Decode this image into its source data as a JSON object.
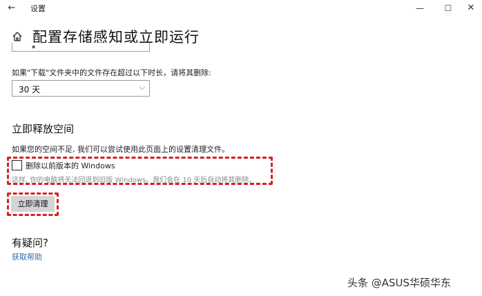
{
  "titlebar": {
    "back_glyph": "←",
    "title": "设置",
    "min_glyph": "—",
    "max_glyph": "☐",
    "close_glyph": "✕"
  },
  "page": {
    "home_icon": "home-icon",
    "title": "配置存储感知或立即运行"
  },
  "downloads": {
    "label": "如果\"下载\"文件夹中的文件存在超过以下时长，请将其删除:",
    "selected": "30 天",
    "chevron": "⌵"
  },
  "free_space": {
    "title": "立即释放空间",
    "description": "如果您的空间不足, 我们可以尝试使用此页面上的设置清理文件。",
    "checkbox_label": "删除以前版本的 Windows",
    "checkbox_checked": false,
    "info": "这样, 你的电脑将无法回退到旧版 Windows。我们会在 10 天后自动将其删除。",
    "button": "立即清理"
  },
  "faq": {
    "title": "有疑问?",
    "link": "获取帮助"
  },
  "watermark": "头条 @ASUS华硕华东",
  "colors": {
    "highlight": "#d62020",
    "link": "#2a6cb0",
    "button_bg": "#d4d4d4"
  }
}
